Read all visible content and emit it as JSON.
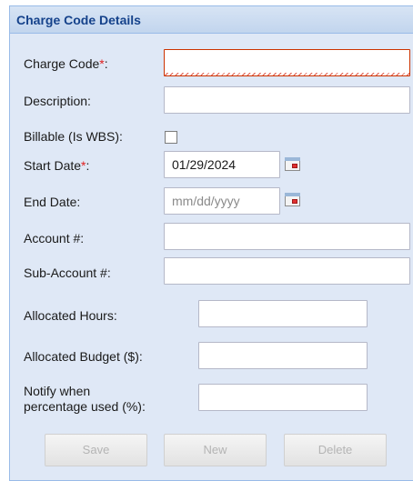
{
  "panel": {
    "title": "Charge Code Details"
  },
  "fields": {
    "charge_code": {
      "label": "Charge Code",
      "required_mark": "*",
      "suffix": ":",
      "value": ""
    },
    "description": {
      "label": "Description:",
      "value": ""
    },
    "billable": {
      "label": "Billable (Is WBS):",
      "checked": false
    },
    "start_date": {
      "label": "Start Date",
      "required_mark": "*",
      "suffix": ":",
      "value": "01/29/2024"
    },
    "end_date": {
      "label": "End Date:",
      "value": "",
      "placeholder": "mm/dd/yyyy"
    },
    "account": {
      "label": "Account #:",
      "value": ""
    },
    "sub_account": {
      "label": "Sub-Account #:",
      "value": ""
    },
    "allocated_hours": {
      "label": "Allocated Hours:",
      "value": ""
    },
    "allocated_budget": {
      "label": "Allocated Budget ($):",
      "value": ""
    },
    "notify": {
      "label_line1": "Notify when",
      "label_line2": "percentage used (%):",
      "value": ""
    }
  },
  "buttons": {
    "save": "Save",
    "new": "New",
    "delete": "Delete"
  },
  "icons": {
    "calendar": "calendar-icon"
  },
  "colors": {
    "panel_bg": "#dfe8f6",
    "header_text": "#15428b",
    "required": "#e02020",
    "invalid_border": "#cc3300"
  }
}
